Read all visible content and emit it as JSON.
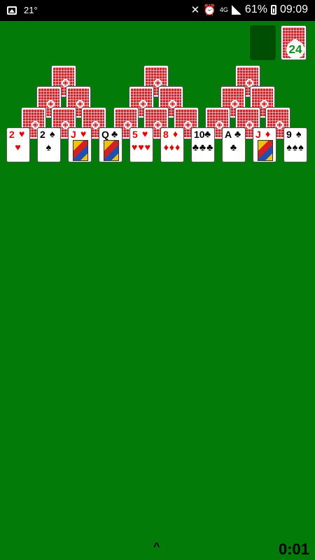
{
  "status_bar": {
    "temperature": "21°",
    "network": "4G",
    "battery": "61%",
    "time": "09:09"
  },
  "colors": {
    "felt": "#037b08",
    "card_back": "#d2242b",
    "red_suit": "#ee0000"
  },
  "stock": {
    "count": "24"
  },
  "pyramid_face_down_cards": 18,
  "bottom_row": [
    {
      "rank": "2",
      "suit": "♥",
      "color": "red",
      "pips": "♥"
    },
    {
      "rank": "2",
      "suit": "♠",
      "color": "black",
      "pips": "♠"
    },
    {
      "rank": "J",
      "suit": "♥",
      "color": "red",
      "face": true
    },
    {
      "rank": "Q",
      "suit": "♣",
      "color": "black",
      "face": true
    },
    {
      "rank": "5",
      "suit": "♥",
      "color": "red",
      "pips": "♥♥♥"
    },
    {
      "rank": "8",
      "suit": "♦",
      "color": "red",
      "pips": "♦♦♦"
    },
    {
      "rank": "10",
      "suit": "♣",
      "color": "black",
      "pips": "♣♣♣"
    },
    {
      "rank": "A",
      "suit": "♣",
      "color": "black",
      "pips": "♣"
    },
    {
      "rank": "J",
      "suit": "♦",
      "color": "red",
      "face": true
    },
    {
      "rank": "9",
      "suit": "♠",
      "color": "black",
      "pips": "♠♠♠"
    }
  ],
  "footer": {
    "caret": "^",
    "timer": "0:01"
  }
}
